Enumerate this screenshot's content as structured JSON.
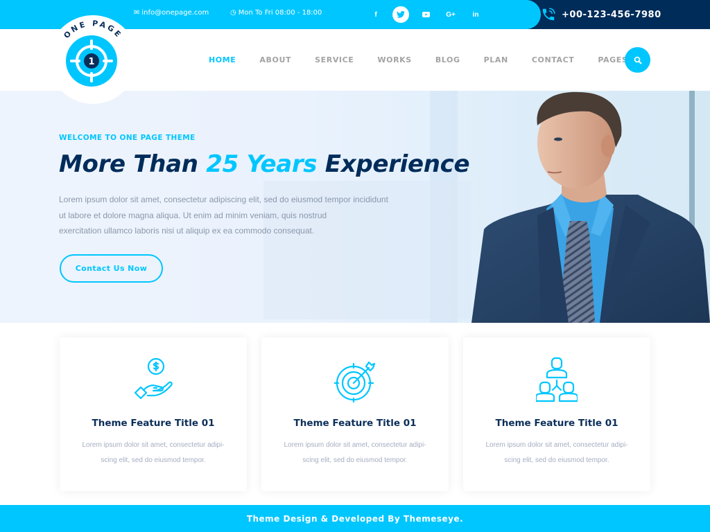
{
  "topbar": {
    "email": "info@onepage.com",
    "hours": "Mon To Fri 08:00 - 18:00",
    "social": [
      {
        "name": "facebook",
        "glyph": "f"
      },
      {
        "name": "twitter",
        "glyph": "t",
        "active": true
      },
      {
        "name": "youtube",
        "glyph": "▶"
      },
      {
        "name": "google-plus",
        "glyph": "G+"
      },
      {
        "name": "linkedin",
        "glyph": "in"
      }
    ],
    "phone": "+00-123-456-7980"
  },
  "logo": {
    "text": "ONE PAGE",
    "number": "1"
  },
  "nav": {
    "items": [
      {
        "label": "HOME",
        "active": true
      },
      {
        "label": "ABOUT"
      },
      {
        "label": "SERVICE"
      },
      {
        "label": "WORKS"
      },
      {
        "label": "BLOG"
      },
      {
        "label": "PLAN"
      },
      {
        "label": "CONTACT"
      },
      {
        "label": "PAGES"
      }
    ],
    "search_icon": "search-icon"
  },
  "hero": {
    "welcome": "WELCOME TO ONE PAGE THEME",
    "title_part1": "More Than ",
    "title_accent": "25 Years",
    "title_part2": " Experience",
    "text_lines": [
      "Lorem ipsum dolor sit amet, consectetur adipiscing elit, sed do eiusmod tempor incididunt",
      "ut labore et dolore magna aliqua. Ut enim ad minim veniam, quis nostrud",
      "exercitation ullamco laboris nisi ut aliquip ex ea commodo consequat."
    ],
    "button_label": "Contact Us Now"
  },
  "features": [
    {
      "icon": "hand-money-icon",
      "title": "Theme Feature Title 01",
      "desc_lines": [
        "Lorem ipsum dolor sit amet, consectetur adipi-",
        "scing elit, sed do eiusmod tempor."
      ]
    },
    {
      "icon": "target-icon",
      "title": "Theme Feature Title 01",
      "desc_lines": [
        "Lorem ipsum dolor sit amet, consectetur adipi-",
        "scing elit, sed do eiusmod tempor."
      ]
    },
    {
      "icon": "team-icon",
      "title": "Theme Feature Title 01",
      "desc_lines": [
        "Lorem ipsum dolor sit amet, consectetur adipi-",
        "scing elit, sed do eiusmod tempor."
      ]
    }
  ],
  "footer": {
    "text": "Theme Design & Developed By Themeseye."
  },
  "colors": {
    "accent": "#00c6ff",
    "navy": "#002c5a",
    "nav_text": "#a3a3a3",
    "body_text": "#8a97aa"
  }
}
